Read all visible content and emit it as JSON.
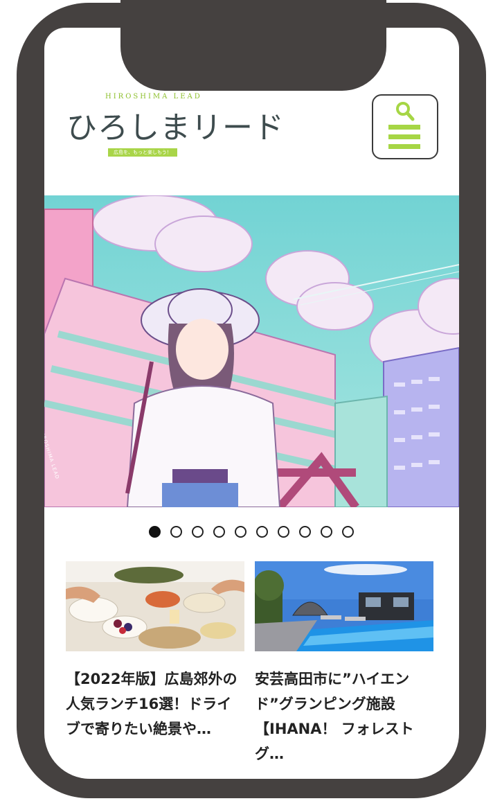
{
  "header": {
    "logo_en": "HIROSHIMA LEAD",
    "logo_jp": "ひろしまリード",
    "logo_tagline": "広島を、もっと楽しもう！"
  },
  "carousel": {
    "hero_watermark": "HIROSHIMA LEAD",
    "total_slides": 10,
    "active_index": 0
  },
  "articles": [
    {
      "title": "【2022年版】広島郊外の人気ランチ16選！ドライブで寄りたい絶景や…"
    },
    {
      "title": "安芸高田市に”ハイエンド”グランピング施設【IHANA！ フォレストグ…"
    }
  ],
  "colors": {
    "frame": "#454140",
    "accent_green": "#a6d645",
    "logo_text": "#3e4c4e"
  },
  "icons": {
    "search": "search-icon",
    "menu": "hamburger-icon"
  }
}
